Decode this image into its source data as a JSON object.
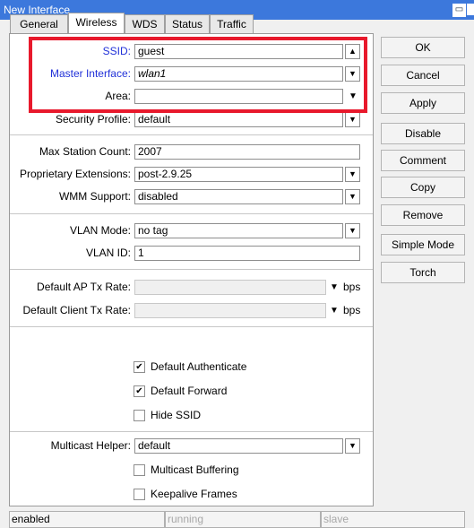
{
  "window": {
    "title": "New Interface"
  },
  "tabs": [
    {
      "label": "General"
    },
    {
      "label": "Wireless"
    },
    {
      "label": "WDS"
    },
    {
      "label": "Status"
    },
    {
      "label": "Traffic"
    }
  ],
  "form": {
    "ssid": {
      "label": "SSID:",
      "value": "guest"
    },
    "master_interface": {
      "label": "Master Interface:",
      "value": "wlan1"
    },
    "area": {
      "label": "Area:",
      "value": ""
    },
    "security_profile": {
      "label": "Security Profile:",
      "value": "default"
    },
    "max_station_count": {
      "label": "Max Station Count:",
      "value": "2007"
    },
    "proprietary_extensions": {
      "label": "Proprietary Extensions:",
      "value": "post-2.9.25"
    },
    "wmm_support": {
      "label": "WMM Support:",
      "value": "disabled"
    },
    "vlan_mode": {
      "label": "VLAN Mode:",
      "value": "no tag"
    },
    "vlan_id": {
      "label": "VLAN ID:",
      "value": "1"
    },
    "default_ap_tx_rate": {
      "label": "Default AP Tx Rate:",
      "value": "",
      "unit": "bps"
    },
    "default_client_tx_rate": {
      "label": "Default Client Tx Rate:",
      "value": "",
      "unit": "bps"
    },
    "default_authenticate": {
      "label": "Default Authenticate",
      "checked": true
    },
    "default_forward": {
      "label": "Default Forward",
      "checked": true
    },
    "hide_ssid": {
      "label": "Hide SSID",
      "checked": false
    },
    "multicast_helper": {
      "label": "Multicast Helper:",
      "value": "default"
    },
    "multicast_buffering": {
      "label": "Multicast Buffering",
      "checked": false
    },
    "keepalive_frames": {
      "label": "Keepalive Frames",
      "checked": false
    }
  },
  "buttons": {
    "ok": "OK",
    "cancel": "Cancel",
    "apply": "Apply",
    "disable": "Disable",
    "comment": "Comment",
    "copy": "Copy",
    "remove": "Remove",
    "simple_mode": "Simple Mode",
    "torch": "Torch"
  },
  "status": {
    "state": "enabled",
    "running": "running",
    "slave": "slave"
  },
  "colors": {
    "titlebar": "#3c78dc",
    "highlight": "#e8192c",
    "link_label": "#2030d8"
  }
}
